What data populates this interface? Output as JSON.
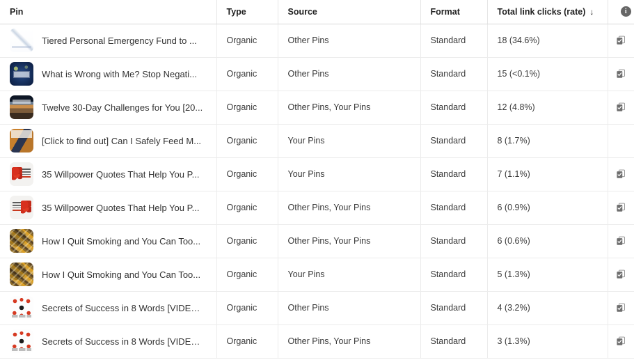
{
  "table": {
    "columns": [
      {
        "key": "pin",
        "label": "Pin",
        "sorted": false
      },
      {
        "key": "type",
        "label": "Type",
        "sorted": false
      },
      {
        "key": "source",
        "label": "Source",
        "sorted": false
      },
      {
        "key": "format",
        "label": "Format",
        "sorted": false
      },
      {
        "key": "clicks",
        "label": "Total link clicks (rate)",
        "sorted": true,
        "sort_arrow": "↓"
      },
      {
        "key": "action",
        "label": "",
        "icon": "info-icon",
        "icon_glyph": "i"
      }
    ],
    "rows": [
      {
        "thumbnail": "line-chart-thumbnail",
        "pin": "Tiered Personal Emergency Fund to ...",
        "type": "Organic",
        "source": "Other Pins",
        "format": "Standard",
        "clicks": "18 (34.6%)",
        "action_icon": "copy-icon"
      },
      {
        "thumbnail": "starry-night-thumbnail",
        "pin": "What is Wrong with Me? Stop Negati...",
        "type": "Organic",
        "source": "Other Pins",
        "format": "Standard",
        "clicks": "15 (<0.1%)",
        "action_icon": "copy-icon"
      },
      {
        "thumbnail": "desert-road-thumbnail",
        "pin": "Twelve 30-Day Challenges for You [20...",
        "type": "Organic",
        "source": "Other Pins, Your Pins",
        "format": "Standard",
        "clicks": "12 (4.8%)",
        "action_icon": "copy-icon"
      },
      {
        "thumbnail": "orange-room-thumbnail",
        "pin": "[Click to find out] Can I Safely Feed M...",
        "type": "Organic",
        "source": "Your Pins",
        "format": "Standard",
        "clicks": "8 (1.7%)",
        "action_icon": ""
      },
      {
        "thumbnail": "berries-left-thumbnail",
        "pin": "35 Willpower Quotes That Help You P...",
        "type": "Organic",
        "source": "Your Pins",
        "format": "Standard",
        "clicks": "7 (1.1%)",
        "action_icon": "copy-icon"
      },
      {
        "thumbnail": "berries-right-thumbnail",
        "pin": "35 Willpower Quotes That Help You P...",
        "type": "Organic",
        "source": "Other Pins, Your Pins",
        "format": "Standard",
        "clicks": "6 (0.9%)",
        "action_icon": "copy-icon"
      },
      {
        "thumbnail": "cigarette-butts-thumbnail",
        "pin": "How I Quit Smoking and You Can Too...",
        "type": "Organic",
        "source": "Other Pins, Your Pins",
        "format": "Standard",
        "clicks": "6 (0.6%)",
        "action_icon": "copy-icon"
      },
      {
        "thumbnail": "cigarette-butts-thumbnail",
        "pin": "How I Quit Smoking and You Can Too...",
        "type": "Organic",
        "source": "Your Pins",
        "format": "Standard",
        "clicks": "5 (1.3%)",
        "action_icon": "copy-icon"
      },
      {
        "thumbnail": "success-infographic-thumbnail",
        "pin": "Secrets of Success in 8 Words [VIDEO...",
        "type": "Organic",
        "source": "Other Pins",
        "format": "Standard",
        "clicks": "4 (3.2%)",
        "action_icon": "copy-icon"
      },
      {
        "thumbnail": "success-infographic-thumbnail",
        "pin": "Secrets of Success in 8 Words [VIDEO...",
        "type": "Organic",
        "source": "Other Pins, Your Pins",
        "format": "Standard",
        "clicks": "3 (1.3%)",
        "action_icon": "copy-icon"
      }
    ]
  },
  "colors": {
    "header_text": "#222222",
    "body_text": "#3a3a3a",
    "row_border": "#ececec",
    "header_border": "#d8d8d8",
    "icon_gray": "#666666"
  }
}
